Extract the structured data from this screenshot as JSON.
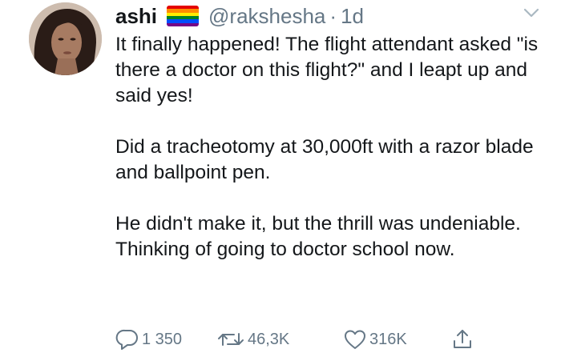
{
  "tweet": {
    "display_name": "ashi",
    "handle": "@rakshesha",
    "separator": "·",
    "time": "1d",
    "paragraphs": [
      "It finally happened! The flight attendant asked \"is there a doctor on this flight?\" and I leapt up and said yes!",
      "Did a tracheotomy at 30,000ft with a razor blade and ballpoint pen.",
      "He didn't make it, but the thrill was undeniable. Thinking of going to doctor school now."
    ]
  },
  "actions": {
    "replies": "1 350",
    "retweets": "46,3K",
    "likes": "316K"
  },
  "icons": {
    "flag": "rainbow-flag-emoji",
    "menu": "chevron-down-icon",
    "reply": "reply-icon",
    "retweet": "retweet-icon",
    "like": "heart-icon",
    "share": "share-icon"
  },
  "colors": {
    "text": "#14171a",
    "secondary": "#657786",
    "flag": [
      "#e40303",
      "#ff8c00",
      "#ffed00",
      "#008026",
      "#004dff",
      "#750787"
    ]
  }
}
